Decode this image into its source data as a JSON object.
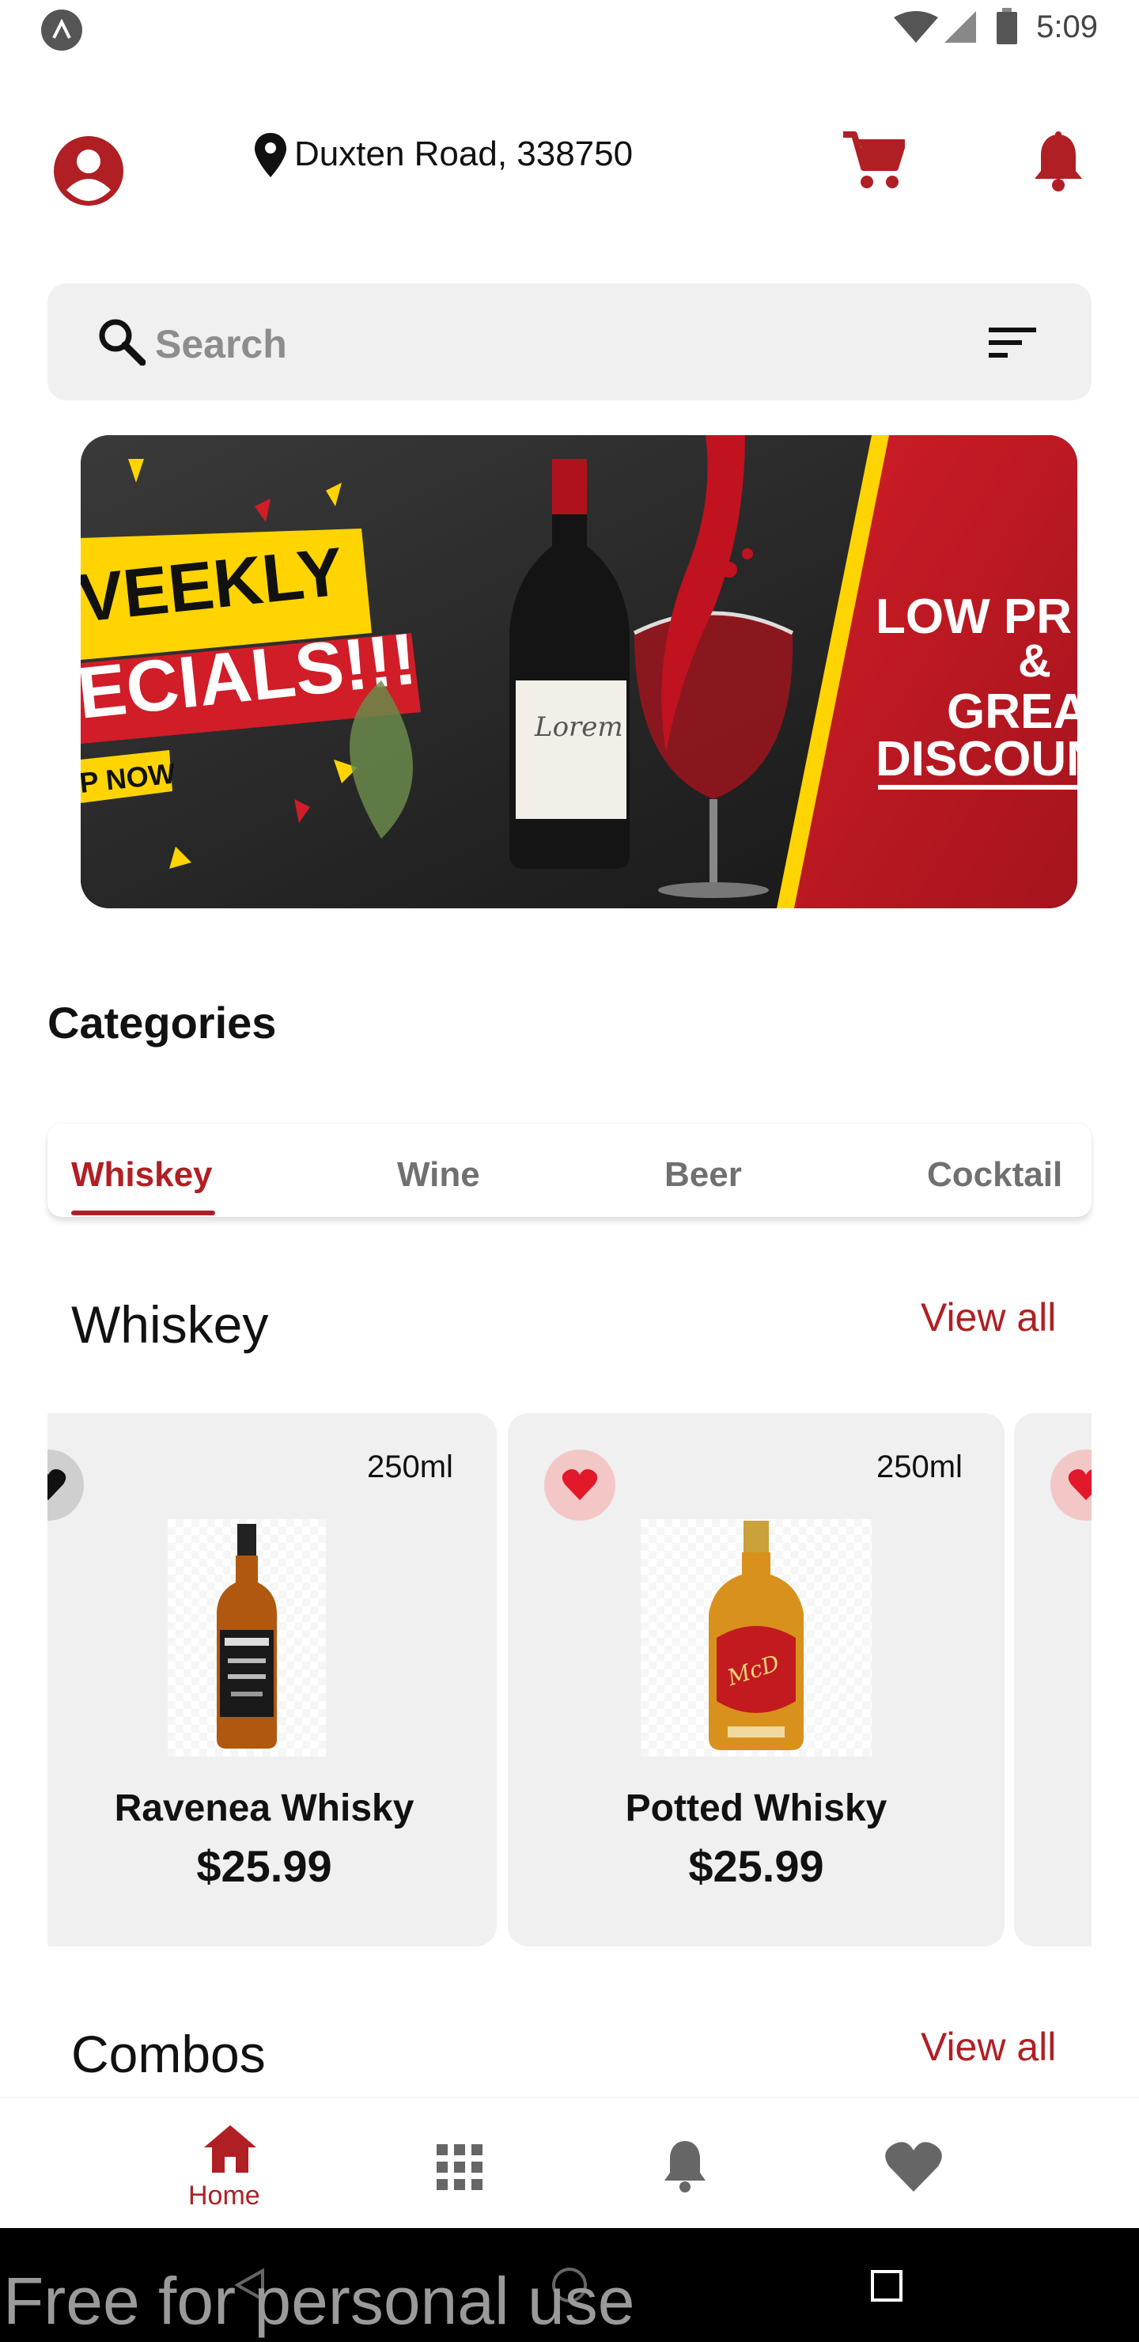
{
  "status_bar": {
    "time": "5:09"
  },
  "header": {
    "location": "Duxten Road, 338750"
  },
  "search": {
    "placeholder": "Search"
  },
  "banner": {
    "line1": "VEEKLY",
    "line2": "ECIALS!!!",
    "line3": "P NOW",
    "right1": "LOW PR",
    "right2": "&",
    "right3": "GREA",
    "right4": "DISCOUN"
  },
  "categories": {
    "title": "Categories",
    "tabs": [
      {
        "label": "Whiskey",
        "active": true
      },
      {
        "label": "Wine",
        "active": false
      },
      {
        "label": "Beer",
        "active": false
      },
      {
        "label": "Cocktail",
        "active": false
      }
    ]
  },
  "whiskey_section": {
    "title": "Whiskey",
    "view_all": "View all",
    "products": [
      {
        "name": "Ravenea Whisky",
        "price": "$25.99",
        "size": "250ml",
        "favorite": "dark"
      },
      {
        "name": "Potted Whisky",
        "price": "$25.99",
        "size": "250ml",
        "favorite": "red"
      }
    ]
  },
  "combos_section": {
    "title": "Combos",
    "view_all": "View all"
  },
  "bottom_nav": {
    "home_label": "Home"
  },
  "watermark": "Free for personal use",
  "colors": {
    "accent": "#b01f24",
    "card_bg": "#f0f0f0",
    "search_bg": "#f0f0f0"
  }
}
